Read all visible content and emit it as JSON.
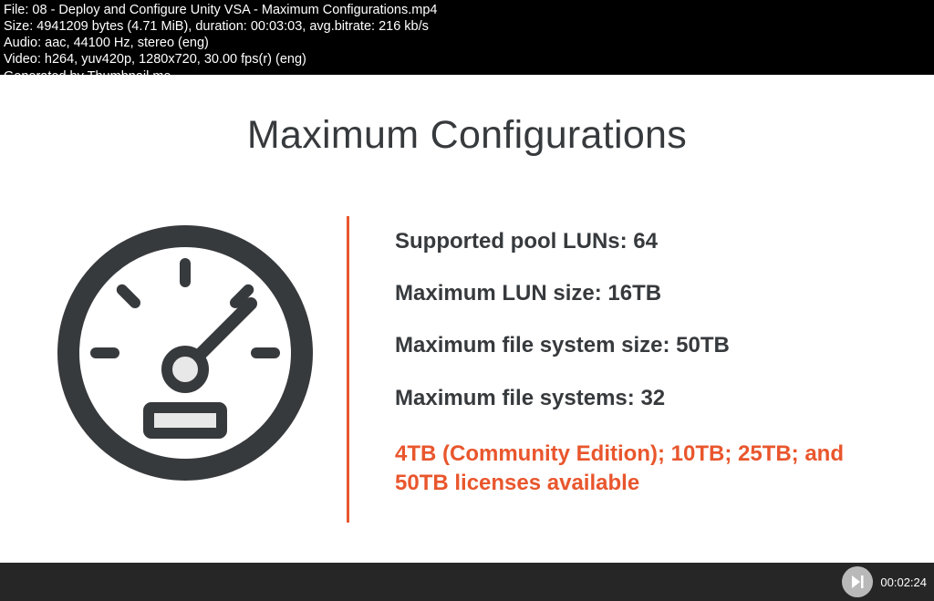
{
  "meta": {
    "file_line": "File: 08 - Deploy and Configure Unity VSA - Maximum Configurations.mp4",
    "size_line": "Size: 4941209 bytes (4.71 MiB), duration: 00:03:03, avg.bitrate: 216 kb/s",
    "audio_line": "Audio: aac, 44100 Hz, stereo (eng)",
    "video_line": "Video: h264, yuv420p, 1280x720, 30.00 fps(r) (eng)",
    "generated_line": "Generated by Thumbnail me"
  },
  "slide": {
    "title": "Maximum Configurations",
    "specs": [
      "Supported pool LUNs: 64",
      "Maximum LUN size: 16TB",
      "Maximum file system size: 50TB",
      "Maximum file systems: 32"
    ],
    "highlight": "4TB (Community Edition); 10TB; 25TB; and 50TB licenses available"
  },
  "player": {
    "timestamp": "00:02:24"
  }
}
